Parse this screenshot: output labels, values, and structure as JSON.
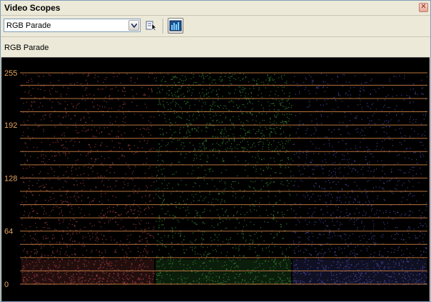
{
  "window": {
    "title": "Video Scopes",
    "close_glyph": "✕"
  },
  "toolbar": {
    "scope_select": {
      "selected": "RGB Parade"
    },
    "pick_icon": "cursor-pick-icon",
    "parade_icon": "parade-histogram-icon"
  },
  "subheader": {
    "label": "RGB Parade"
  },
  "colors": {
    "graticule": "#b8733e",
    "label": "#e2a35f",
    "red": "#c24c4c",
    "green": "#3fa23f",
    "blue": "#5a5ac8",
    "background": "#000000"
  },
  "scope": {
    "ylim": [
      0,
      255
    ],
    "tick_labels": [
      "255",
      "192",
      "128",
      "64",
      "0"
    ],
    "channels": [
      "red",
      "green",
      "blue"
    ]
  }
}
